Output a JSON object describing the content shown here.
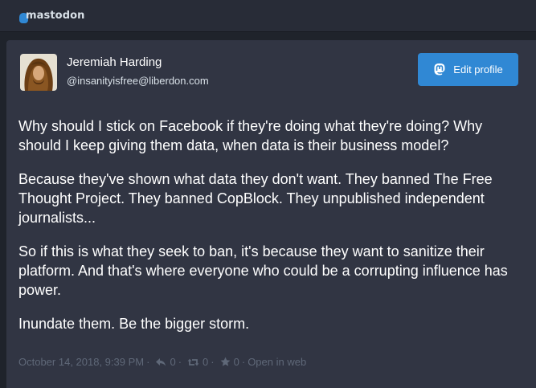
{
  "brand": {
    "logo_text": "mastodon",
    "accent": "#3088d4"
  },
  "profile": {
    "display_name": "Jeremiah Harding",
    "handle": "@insanityisfree@liberdon.com",
    "edit_label": "Edit profile",
    "avatar_icon": "avatar-photo"
  },
  "status": {
    "paragraphs": [
      "Why should I stick on Facebook if they're doing what they're doing? Why should I keep giving them data, when data is their business model?",
      "Because they've shown what data they don't want. They banned The Free Thought Project. They banned CopBlock. They unpublished independent journalists...",
      "So if this is what they seek to ban, it's because they want to sanitize their platform. And that's where everyone who could be a corrupting influence has power.",
      "Inundate them. Be the bigger storm."
    ],
    "timestamp": "October 14, 2018, 9:39 PM",
    "reply_count": "0",
    "boost_count": "0",
    "favourite_count": "0",
    "open_in_web_label": "Open in web",
    "separator": "·",
    "icons": {
      "reply": "reply-icon",
      "boost": "boost-icon",
      "favourite": "star-icon"
    }
  }
}
